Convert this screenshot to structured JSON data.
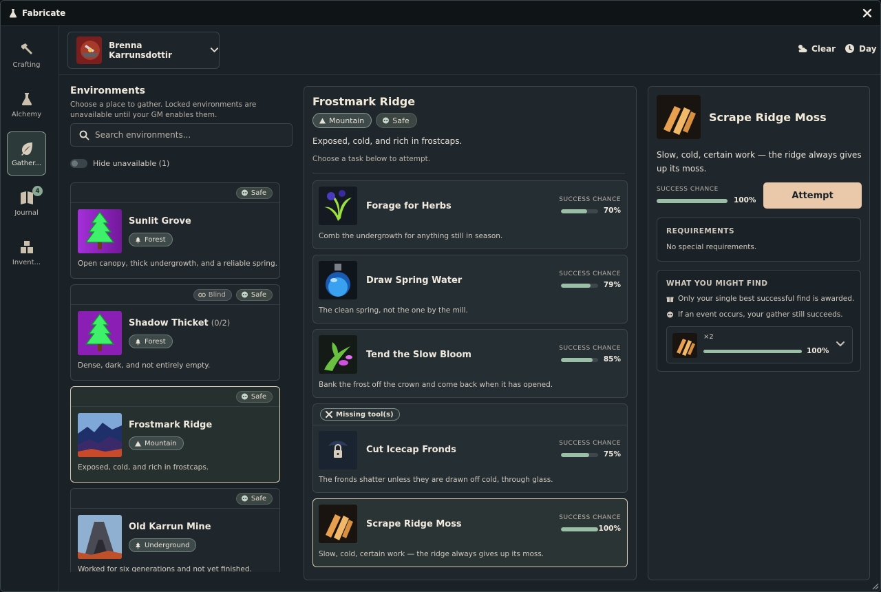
{
  "titlebar": {
    "title": "Fabricate"
  },
  "nav": {
    "items": [
      {
        "label": "Crafting",
        "icon": "hammer-icon"
      },
      {
        "label": "Alchemy",
        "icon": "flask-icon"
      },
      {
        "label": "Gather...",
        "icon": "leaf-icon",
        "active": true
      },
      {
        "label": "Journal",
        "icon": "book-icon",
        "badge": "4"
      },
      {
        "label": "Invent...",
        "icon": "boxes-icon"
      }
    ]
  },
  "header": {
    "actor_name": "Brenna Karrunsdottir",
    "weather": "Clear",
    "time_of_day": "Day"
  },
  "environments": {
    "title": "Environments",
    "description": "Choose a place to gather. Locked environments are unavailable until your GM enables them.",
    "search_placeholder": "Search environments...",
    "hide_unavailable_label": "Hide unavailable (1)",
    "items": [
      {
        "name": "Sunlit Grove",
        "count": "",
        "terrain": "Forest",
        "tags": [
          "Safe"
        ],
        "description": "Open canopy, thick undergrowth, and a reliable spring."
      },
      {
        "name": "Shadow Thicket",
        "count": "(0/2)",
        "terrain": "Forest",
        "tags": [
          "Blind",
          "Safe"
        ],
        "description": "Dense, dark, and not entirely empty."
      },
      {
        "name": "Frostmark Ridge",
        "count": "",
        "terrain": "Mountain",
        "tags": [
          "Safe"
        ],
        "description": "Exposed, cold, and rich in frostcaps.",
        "selected": true
      },
      {
        "name": "Old Karrun Mine",
        "count": "",
        "terrain": "Underground",
        "tags": [
          "Safe"
        ],
        "description": "Worked for six generations and not yet finished."
      }
    ]
  },
  "location": {
    "title": "Frostmark Ridge",
    "terrain": "Mountain",
    "safety": "Safe",
    "description": "Exposed, cold, and rich in frostcaps.",
    "hint": "Choose a task below to attempt.",
    "success_label": "SUCCESS CHANCE",
    "missing_tools_label": "Missing tool(s)",
    "tasks": [
      {
        "name": "Forage for Herbs",
        "chance": "70%",
        "fill": 0.7,
        "description": "Comb the undergrowth for anything still in season."
      },
      {
        "name": "Draw Spring Water",
        "chance": "79%",
        "fill": 0.79,
        "description": "The clean spring, not the one by the mill."
      },
      {
        "name": "Tend the Slow Bloom",
        "chance": "85%",
        "fill": 0.85,
        "description": "Bank the frost off the crown and come back when it has opened."
      },
      {
        "name": "Cut Icecap Fronds",
        "chance": "75%",
        "fill": 0.75,
        "description": "The fronds shatter unless they are drawn off cold, through glass.",
        "locked": true
      },
      {
        "name": "Scrape Ridge Moss",
        "chance": "100%",
        "fill": 1.0,
        "description": "Slow, cold, certain work — the ridge always gives up its moss.",
        "selected": true
      }
    ]
  },
  "detail": {
    "title": "Scrape Ridge Moss",
    "description": "Slow, cold, certain work — the ridge always gives up its moss.",
    "success_label": "SUCCESS CHANCE",
    "chance": "100%",
    "chance_fill": 1.0,
    "attempt_label": "Attempt",
    "requirements_title": "REQUIREMENTS",
    "requirements_text": "No special requirements.",
    "find_title": "WHAT YOU MIGHT FIND",
    "find_note_1": "Only your single best successful find is awarded.",
    "find_note_2": "If an event occurs, your gather still succeeds.",
    "loot": {
      "quantity": "×2",
      "chance": "100%",
      "fill": 1.0
    }
  },
  "colors": {
    "accent": "#e9c9a9",
    "success_bar": "#9bbfa6",
    "background": "#1b2227"
  }
}
